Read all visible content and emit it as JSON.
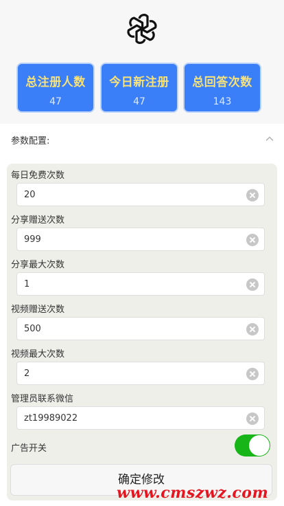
{
  "stats": [
    {
      "title": "总注册人数",
      "value": "47"
    },
    {
      "title": "今日新注册",
      "value": "47"
    },
    {
      "title": "总回答次数",
      "value": "143"
    }
  ],
  "config": {
    "title": "参数配置:",
    "fields": [
      {
        "label": "每日免费次数",
        "value": "20"
      },
      {
        "label": "分享赠送次数",
        "value": "999"
      },
      {
        "label": "分享最大次数",
        "value": "1"
      },
      {
        "label": "视频赠送次数",
        "value": "500"
      },
      {
        "label": "视频最大次数",
        "value": "2"
      },
      {
        "label": "管理员联系微信",
        "value": "zt19989022"
      }
    ],
    "ad_switch_label": "广告开关",
    "ad_switch_on": true,
    "submit_label": "确定修改"
  },
  "watermark": "www.cmszwz.com",
  "colors": {
    "stat_bg": "#3a7ef8",
    "stat_title": "#f7e27a",
    "switch_on": "#17b517"
  }
}
